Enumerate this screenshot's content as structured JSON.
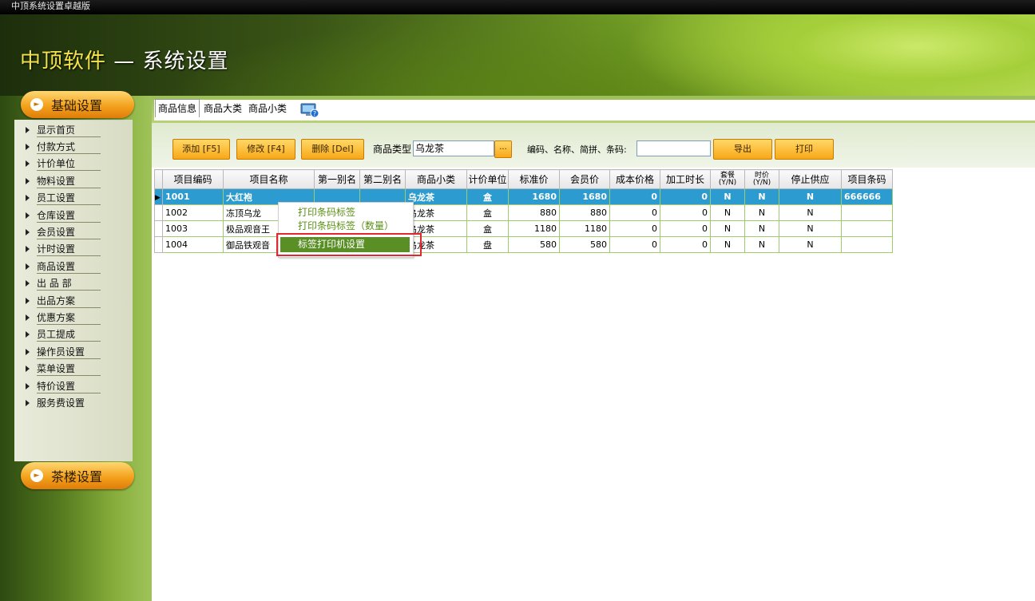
{
  "window": {
    "title": "中顶系统设置卓越版"
  },
  "banner": {
    "brand": "中顶软件",
    "rest": " — 系统设置"
  },
  "sidebar": {
    "group1": "基础设置",
    "group2": "茶楼设置",
    "items": [
      "显示首页",
      "付款方式",
      "计价单位",
      "物料设置",
      "员工设置",
      "仓库设置",
      "会员设置",
      "计时设置",
      "商品设置",
      "出 品 部",
      "出品方案",
      "优惠方案",
      "员工提成",
      "操作员设置",
      "菜单设置",
      "特价设置",
      "服务费设置"
    ]
  },
  "tabs": [
    "商品信息",
    "商品大类",
    "商品小类"
  ],
  "toolbar": {
    "add": "添加 [F5]",
    "edit": "修改 [F4]",
    "delete": "删除 [Del]",
    "type_label": "商品类型",
    "type_value": "乌龙茶",
    "browse": "...",
    "search_label": "编码、名称、简拼、条码:",
    "search_value": "",
    "export": "导出",
    "print": "打印"
  },
  "grid": {
    "headers": [
      "项目编码",
      "项目名称",
      "第一别名",
      "第二别名",
      "商品小类",
      "计价单位",
      "标准价",
      "会员价",
      "成本价格",
      "加工时长",
      "套餐\n(Y/N)",
      "时价\n(Y/N)",
      "停止供应",
      "项目条码"
    ],
    "rows": [
      [
        "1001",
        "大红袍",
        "",
        "",
        "乌龙茶",
        "盒",
        "1680",
        "1680",
        "0",
        "0",
        "N",
        "N",
        "N",
        "666666"
      ],
      [
        "1002",
        "冻顶乌龙",
        "",
        "",
        "乌龙茶",
        "盒",
        "880",
        "880",
        "0",
        "0",
        "N",
        "N",
        "N",
        ""
      ],
      [
        "1003",
        "极品观音王",
        "",
        "",
        "乌龙茶",
        "盒",
        "1180",
        "1180",
        "0",
        "0",
        "N",
        "N",
        "N",
        ""
      ],
      [
        "1004",
        "御品铁观音",
        "",
        "",
        "乌龙茶",
        "盘",
        "580",
        "580",
        "0",
        "0",
        "N",
        "N",
        "N",
        ""
      ]
    ]
  },
  "context_menu": [
    "打印条码标签",
    "打印条码标签（数量）",
    "标签打印机设置"
  ]
}
